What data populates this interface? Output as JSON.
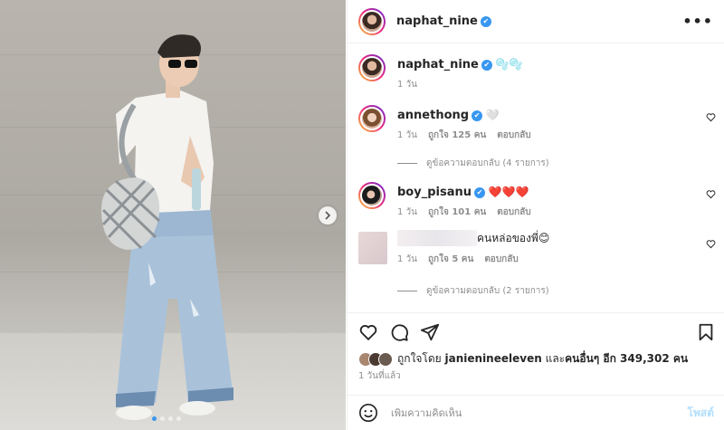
{
  "post": {
    "author": "naphat_nine",
    "verified_mark": "✔",
    "more_icon": "more-horizontal-icon"
  },
  "caption": {
    "username": "naphat_nine",
    "text": "🫧🫧",
    "time": "1 วัน"
  },
  "comments": [
    {
      "username": "annethong",
      "text": "🤍",
      "time": "1 วัน",
      "likes": "ถูกใจ 125 คน",
      "reply": "ตอบกลับ",
      "view_replies": "ดูข้อความตอบกลับ (4 รายการ)"
    },
    {
      "username": "boy_pisanu",
      "text": "❤️❤️❤️",
      "time": "1 วัน",
      "likes": "ถูกใจ 101 คน",
      "reply": "ตอบกลับ"
    },
    {
      "username": "",
      "text": "คนหล่อของพี่😊",
      "time": "1 วัน",
      "likes": "ถูกใจ 5 คน",
      "reply": "ตอบกลับ",
      "view_replies": "ดูข้อความตอบกลับ (2 รายการ)"
    }
  ],
  "likes_summary": {
    "prefix": "ถูกใจโดย ",
    "user": "janienineeleven",
    "middle": " และ",
    "others": "คนอื่นๆ อีก 349,302 คน"
  },
  "posted_ago": "1 วันที่แล้ว",
  "add_comment": {
    "placeholder": "เพิ่มความคิดเห็น",
    "post_label": "โพสต์"
  },
  "carousel": {
    "total": 4,
    "active_index": 0
  },
  "colors": {
    "verified": "#3897f0",
    "post_button": "#b2dffc",
    "secondary_text": "#8e8e8e"
  }
}
